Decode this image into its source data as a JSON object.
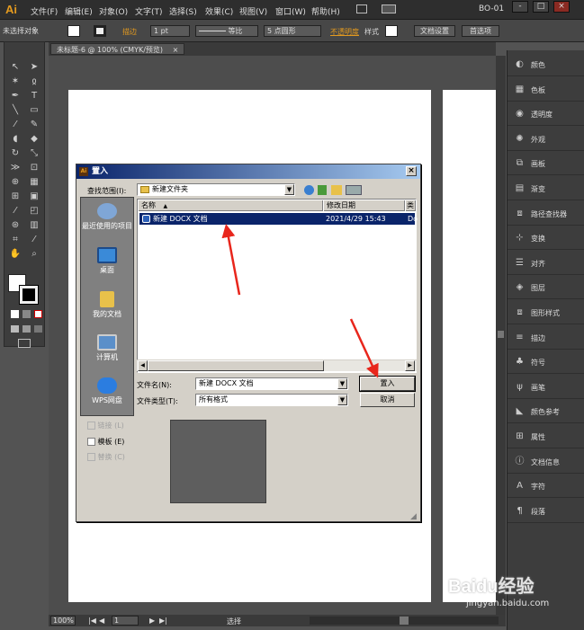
{
  "app": {
    "logo": "Ai",
    "menu": [
      "文件(F)",
      "编辑(E)",
      "对象(O)",
      "文字(T)",
      "选择(S)",
      "效果(C)",
      "视图(V)",
      "窗口(W)",
      "帮助(H)"
    ],
    "workspace": "BO-01",
    "window_controls": [
      "-",
      "□",
      "×"
    ]
  },
  "control_bar": {
    "selection": "未选择对象",
    "stroke_label": "描边",
    "stroke_weight": "1 pt",
    "line_style": "等比",
    "brush": "5 点圆形",
    "opacity_label": "不透明度",
    "style_label": "样式",
    "doc_setup_button": "文档设置",
    "prefs_button": "首选项"
  },
  "document_tab": {
    "title": "未标题-6 @ 100% (CMYK/预览)",
    "close": "×"
  },
  "status_bar": {
    "zoom": "100%",
    "page": "1",
    "tool": "选择"
  },
  "right_panel": {
    "items": [
      {
        "icon": "color-icon",
        "label": "颜色"
      },
      {
        "icon": "swatches-icon",
        "label": "色板"
      },
      {
        "icon": "transparency-icon",
        "label": "透明度"
      },
      {
        "icon": "appearance-icon",
        "label": "外观"
      },
      {
        "icon": "artboards-icon",
        "label": "画板"
      },
      {
        "icon": "gradient-icon",
        "label": "渐变"
      },
      {
        "icon": "pathfinder-icon",
        "label": "路径查找器"
      },
      {
        "icon": "transform-icon",
        "label": "变换"
      },
      {
        "icon": "align-icon",
        "label": "对齐"
      },
      {
        "icon": "layers-icon",
        "label": "图层"
      },
      {
        "icon": "graphic-styles-icon",
        "label": "图形样式"
      },
      {
        "icon": "stroke-icon",
        "label": "描边"
      },
      {
        "icon": "symbols-icon",
        "label": "符号"
      },
      {
        "icon": "brushes-icon",
        "label": "画笔"
      },
      {
        "icon": "color-guide-icon",
        "label": "颜色参考"
      },
      {
        "icon": "attributes-icon",
        "label": "属性"
      },
      {
        "icon": "document-info-icon",
        "label": "文档信息"
      },
      {
        "icon": "character-icon",
        "label": "字符"
      },
      {
        "icon": "paragraph-icon",
        "label": "段落"
      }
    ]
  },
  "dialog": {
    "title": "置入",
    "close": "×",
    "look_in_label": "查找范围(I):",
    "look_in_value": "新建文件夹",
    "places": [
      {
        "label": "最近使用的项目"
      },
      {
        "label": "桌面"
      },
      {
        "label": "我的文档"
      },
      {
        "label": "计算机"
      },
      {
        "label": "WPS网盘"
      }
    ],
    "columns": [
      "名称",
      "修改日期",
      "类"
    ],
    "files": [
      {
        "name": "新建 DOCX 文档",
        "date": "2021/4/29 15:43",
        "type": "Do"
      }
    ],
    "filename_label": "文件名(N):",
    "filename_value": "新建 DOCX 文档",
    "filetype_label": "文件类型(T):",
    "filetype_value": "所有格式",
    "place_button": "置入",
    "cancel_button": "取消",
    "options": [
      {
        "label": "链接 (L)",
        "enabled": false,
        "checked": false
      },
      {
        "label": "模板 (E)",
        "enabled": true,
        "checked": false
      },
      {
        "label": "替换 (C)",
        "enabled": false,
        "checked": false
      }
    ]
  },
  "watermark": {
    "brand": "Baidu经验",
    "url": "jingyan.baidu.com"
  },
  "colors": {
    "accent_orange": "#e39a1f",
    "selection_blue": "#0a246a",
    "annotation_red": "#e8261c"
  }
}
